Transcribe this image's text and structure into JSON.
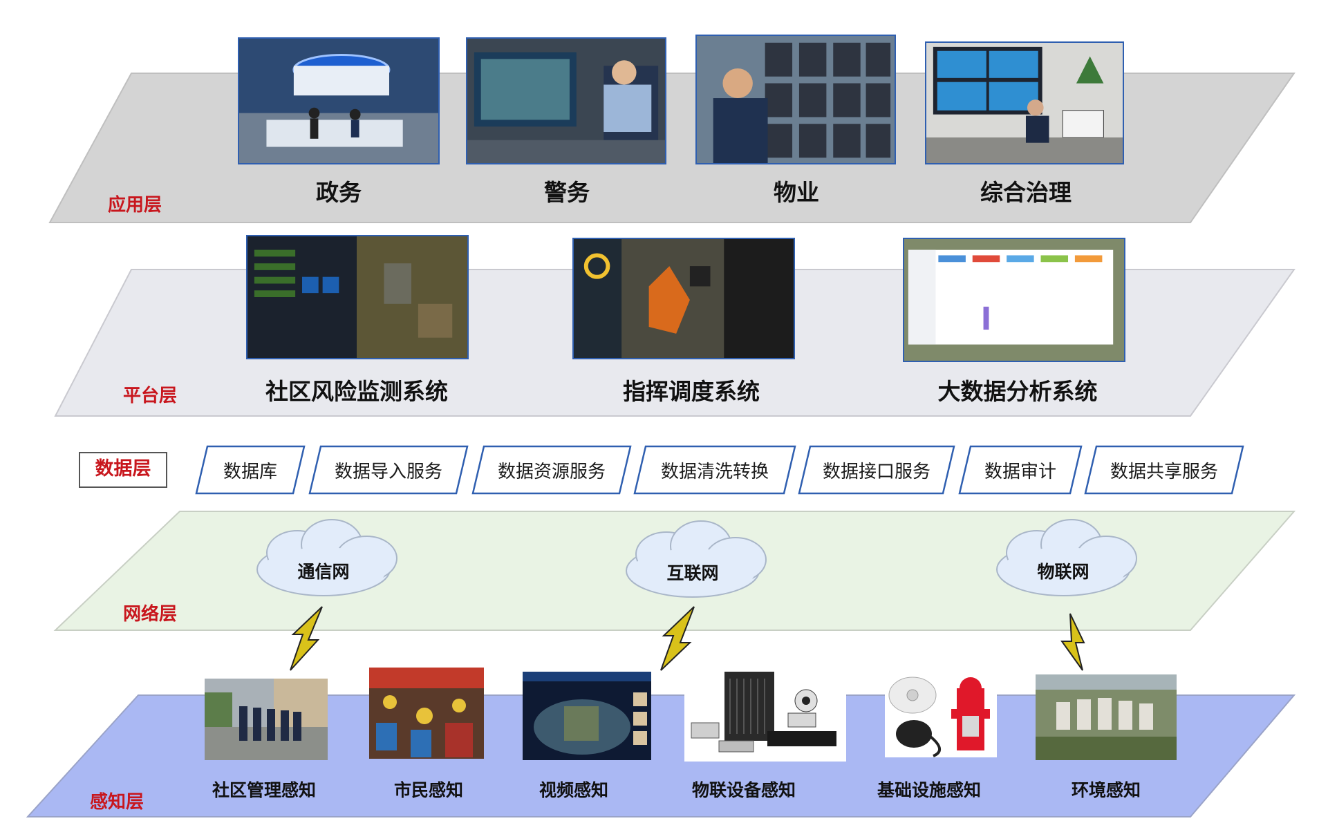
{
  "layers": {
    "application": {
      "label": "应用层",
      "items": [
        "政务",
        "警务",
        "物业",
        "综合治理"
      ]
    },
    "platform": {
      "label": "平台层",
      "items": [
        "社区风险监测系统",
        "指挥调度系统",
        "大数据分析系统"
      ]
    },
    "data": {
      "label": "数据层",
      "items": [
        "数据库",
        "数据导入服务",
        "数据资源服务",
        "数据清洗转换",
        "数据接口服务",
        "数据审计",
        "数据共享服务"
      ]
    },
    "network": {
      "label": "网络层",
      "items": [
        "通信网",
        "互联网",
        "物联网"
      ]
    },
    "perception": {
      "label": "感知层",
      "items": [
        "社区管理感知",
        "市民感知",
        "视频感知",
        "物联设备感知",
        "基础设施感知",
        "环境感知"
      ]
    }
  },
  "colors": {
    "label_red": "#c8161d",
    "application_plane": "#d4d4d4",
    "platform_plane": "#e8e9ee",
    "network_plane": "#e9f3e4",
    "perception_plane": "#aab8f3",
    "box_border": "#2f5fb0",
    "lightning": "#d9c21a"
  }
}
